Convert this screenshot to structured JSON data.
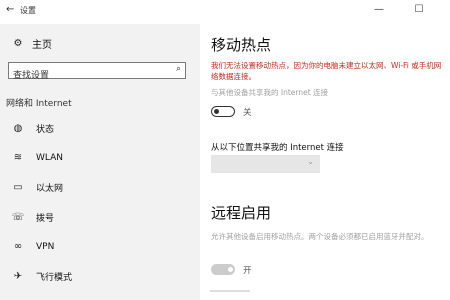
{
  "window": {
    "title": "设置",
    "back_icon": "←",
    "minimize": "—",
    "maximize": "☐"
  },
  "sidebar": {
    "home": {
      "icon": "gear-icon",
      "label": "主页"
    },
    "search": {
      "placeholder": "查找设置"
    },
    "section_title": "网络和 Internet",
    "items": [
      {
        "icon": "globe-icon",
        "label": "状态"
      },
      {
        "icon": "wifi-icon",
        "label": "WLAN"
      },
      {
        "icon": "monitor-icon",
        "label": "以太网"
      },
      {
        "icon": "dialup-icon",
        "label": "拨号"
      },
      {
        "icon": "vpn-icon",
        "label": "VPN"
      },
      {
        "icon": "airplane-icon",
        "label": "飞行模式"
      }
    ]
  },
  "main": {
    "hotspot": {
      "title": "移动热点",
      "error": "我们无法设置移动热点，因为你的电脑未建立以太网、Wi-Fi 或手机网络数据连接。",
      "share_label": "与其他设备共享我的 Internet 连接",
      "toggle_state": "关",
      "from_label": "从以下位置共享我的 Internet 连接"
    },
    "remote": {
      "title": "远程启用",
      "description": "允许其他设备启用移动热点。两个设备必须都已启用蓝牙并配对。",
      "toggle_state": "开"
    }
  },
  "colors": {
    "error": "#c42b1c",
    "sidebar_bg": "#f2f2f2",
    "disabled_text": "#a0a0a0"
  }
}
